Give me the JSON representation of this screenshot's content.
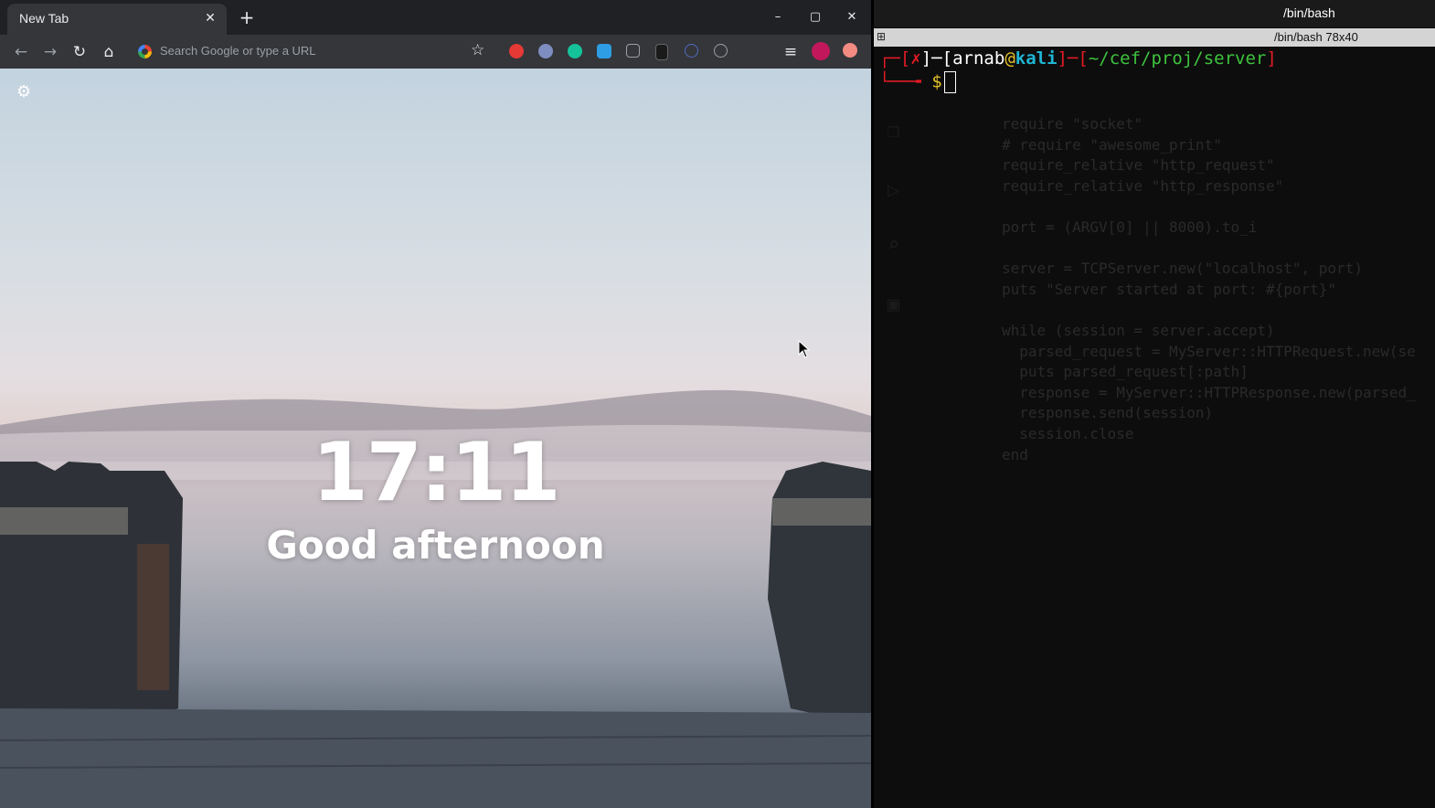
{
  "browser": {
    "tab": {
      "title": "New Tab",
      "close_label": "✕"
    },
    "new_tab_label": "+",
    "window_controls": {
      "minimize": "–",
      "maximize": "▢",
      "close": "✕"
    },
    "nav": {
      "back": "←",
      "forward": "→",
      "reload": "↻",
      "home": "⌂"
    },
    "omnibox": {
      "placeholder": "Search Google or type a URL"
    },
    "bookmark_star": "☆",
    "extensions": [
      {
        "name": "shield-extension-icon",
        "color": "#e53935"
      },
      {
        "name": "wappalyzer-extension-icon",
        "color": "#7e8ec0"
      },
      {
        "name": "grammarly-extension-icon",
        "color": "#15c39a"
      },
      {
        "name": "image-extension-icon",
        "color": "#2f9de4"
      },
      {
        "name": "glasses-extension-icon",
        "color": "#9aa0a6"
      },
      {
        "name": "m-extension-icon",
        "color": "#1a1a1a"
      },
      {
        "name": "react-extension-icon",
        "color": "#4f6bbf"
      },
      {
        "name": "timer-extension-icon",
        "color": "#9aa0a6"
      }
    ],
    "media_icon": "≡",
    "profile_color": "#c2185b",
    "update_color": "#f28b82"
  },
  "ntp": {
    "settings_icon": "⚙",
    "clock": "17:11",
    "greeting": "Good afternoon"
  },
  "terminal": {
    "window_title": "/bin/bash",
    "tab_title": "/bin/bash 78x40",
    "prompt": {
      "open_bracket": "┌─[",
      "status": "✗",
      "sep1": "]─[",
      "user": "arnab",
      "at": "@",
      "host": "kali",
      "sep2": "]─[",
      "path": "~/cef/proj/server",
      "close_bracket": "]",
      "corner": "└──╼ ",
      "dollar": "$"
    }
  }
}
